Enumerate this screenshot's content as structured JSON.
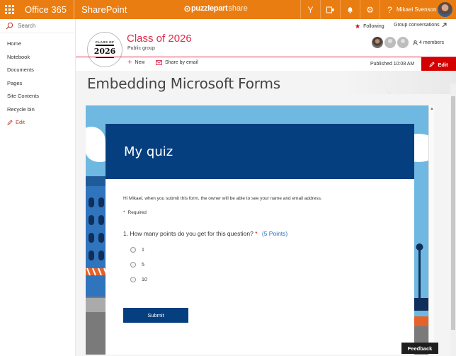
{
  "suite": {
    "app_name": "Office 365",
    "product": "SharePoint",
    "brand_a": "puzzlepart",
    "brand_b": "share",
    "user_name": "Mikael Svenson",
    "icons": [
      "yammer-icon",
      "skype-icon",
      "bell-icon",
      "gear-icon",
      "help-icon"
    ],
    "icon_glyphs": [
      "Y",
      "S",
      "♪",
      "⚙",
      "?"
    ],
    "accent": "#ea7d12"
  },
  "leftnav": {
    "search_placeholder": "Search",
    "items": [
      "Home",
      "Notebook",
      "Documents",
      "Pages",
      "Site Contents",
      "Recycle bin"
    ],
    "edit_label": "Edit"
  },
  "header": {
    "following_label": "Following",
    "group_conversations_label": "Group conversations",
    "site_title": "Class of 2026",
    "site_subtitle": "Public group",
    "logo_top": "CLASS OF",
    "logo_year": "2026",
    "members_label": "4 members",
    "title_color": "#e02b4b"
  },
  "commandbar": {
    "new_label": "New",
    "share_label": "Share by email",
    "published_label": "Published 10:08 AM",
    "edit_label": "Edit"
  },
  "page": {
    "title": "Embedding Microsoft Forms"
  },
  "form": {
    "title": "My quiz",
    "notice": "Hi Mikael, when you submit this form, the owner will be able to see your name and email address.",
    "required_label": "Required",
    "question": "1. How many points do you get for this question?",
    "question_points": "(5 Points)",
    "options": [
      "1",
      "5",
      "10"
    ],
    "submit_label": "Submit",
    "header_color": "#053f7f"
  },
  "feedback_label": "Feedback"
}
